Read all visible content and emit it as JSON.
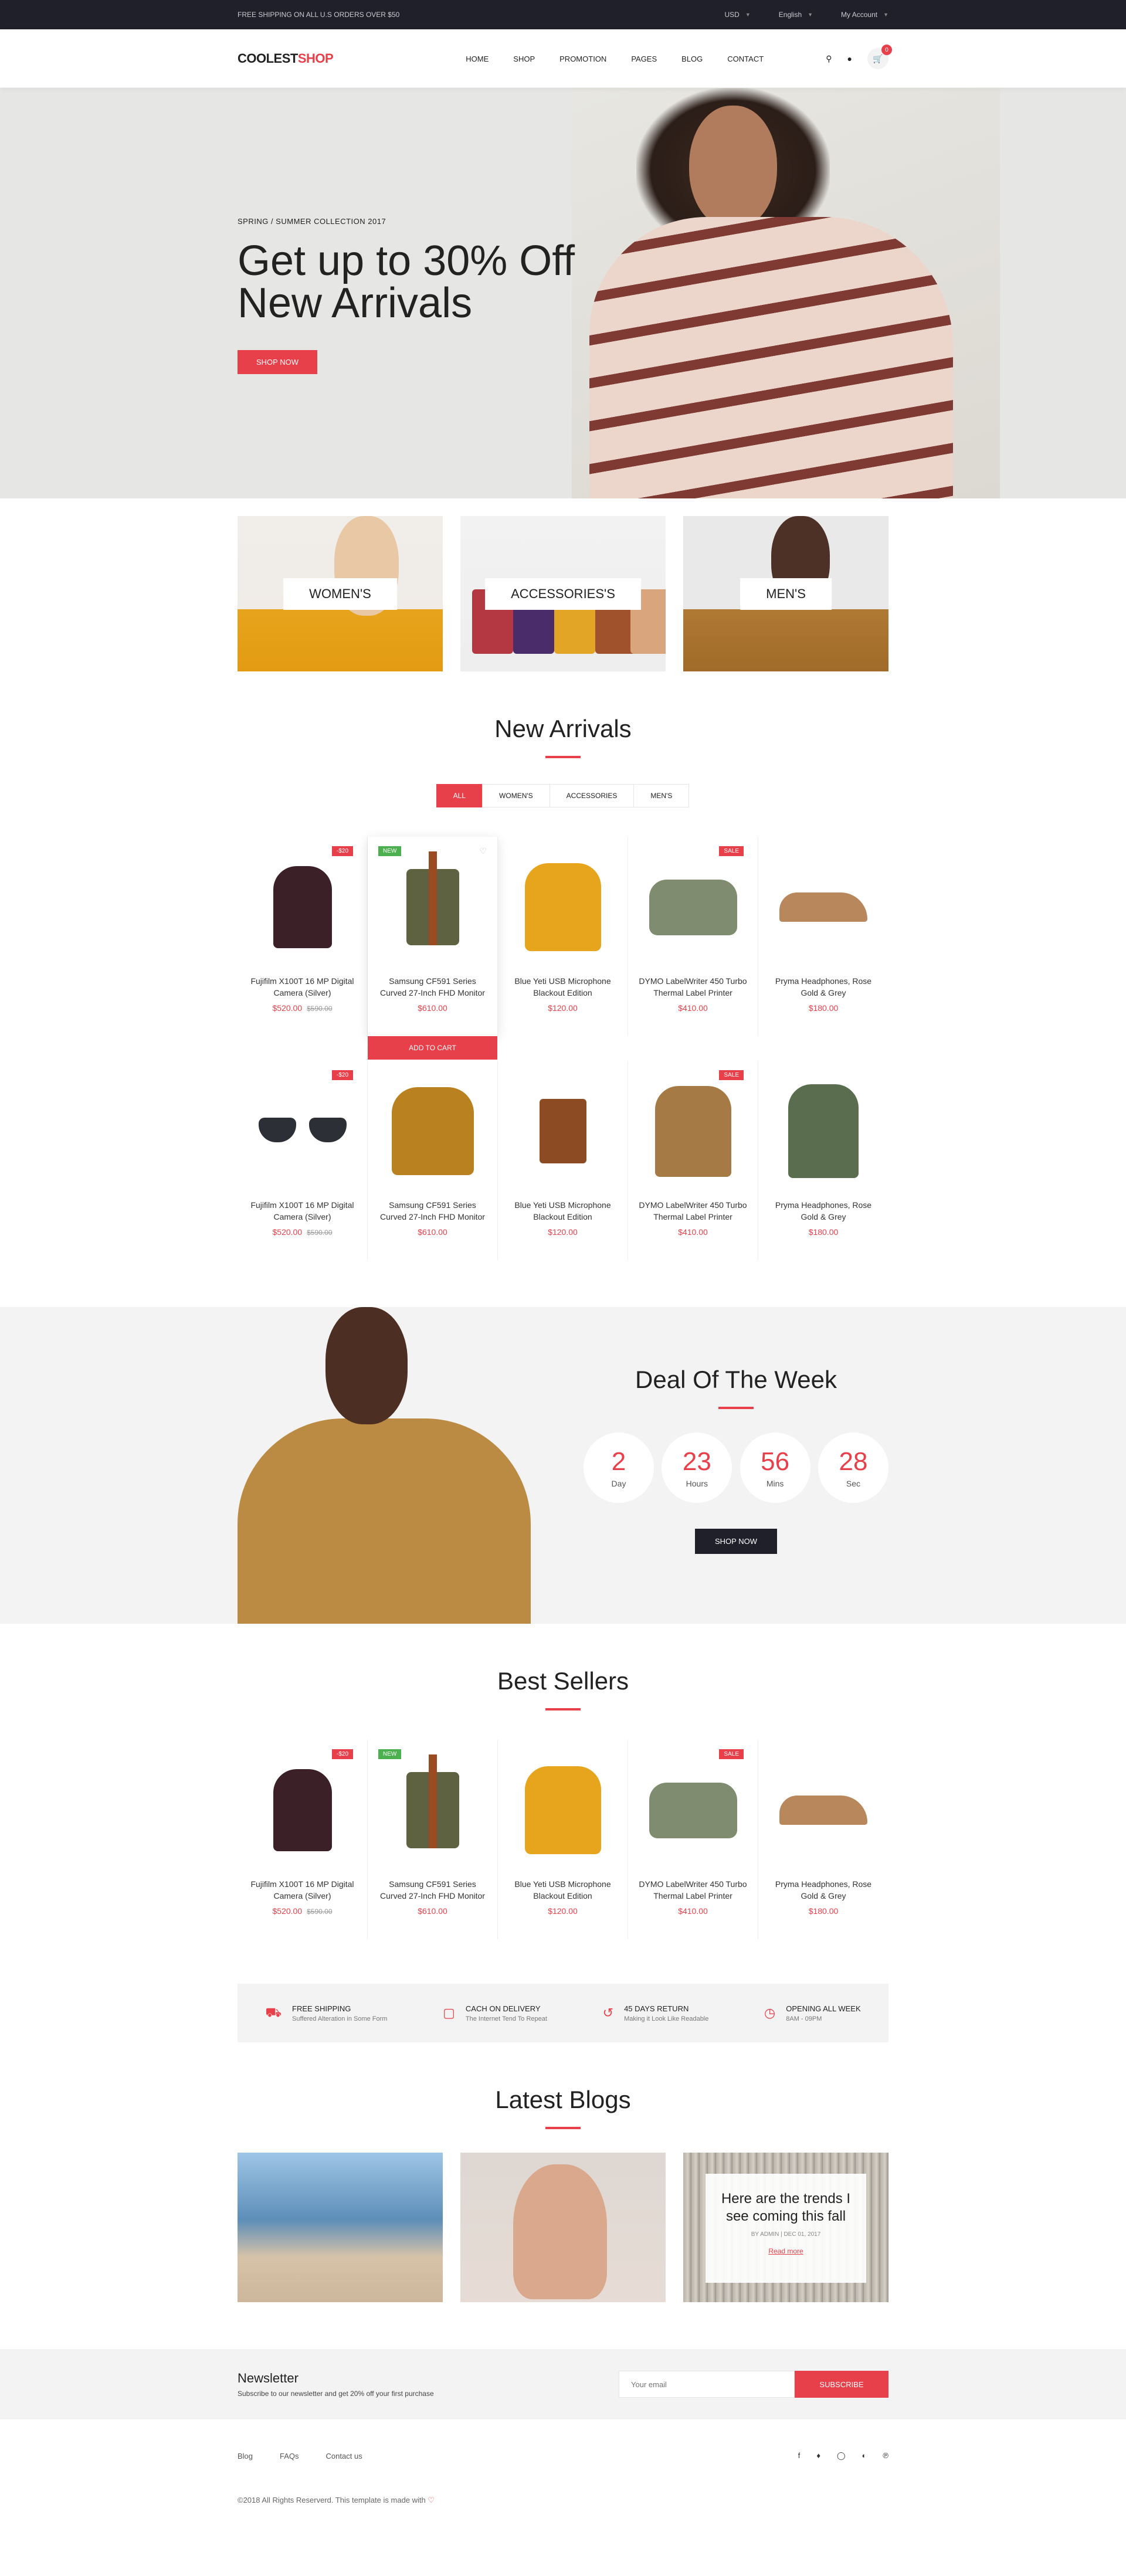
{
  "topbar": {
    "shipping": "FREE SHIPPING ON ALL U.S ORDERS OVER $50",
    "currency": "USD",
    "language": "English",
    "account": "My Account"
  },
  "header": {
    "logo_a": "COOLEST",
    "logo_b": "SHOP",
    "nav": [
      "HOME",
      "SHOP",
      "PROMOTION",
      "PAGES",
      "BLOG",
      "CONTACT"
    ],
    "cart_count": "0"
  },
  "hero": {
    "subtitle": "SPRING / SUMMER COLLECTION 2017",
    "title": "Get up to 30% Off New Arrivals",
    "button": "SHOP NOW"
  },
  "categories": [
    "WOMEN'S",
    "ACCESSORIES'S",
    "MEN'S"
  ],
  "new_arrivals": {
    "title": "New Arrivals",
    "filters": [
      "ALL",
      "WOMEN'S",
      "ACCESSORIES",
      "MEN'S"
    ],
    "add_to_cart": "ADD TO CART",
    "row1": [
      {
        "name": "Fujifilm X100T 16 MP Digital Camera (Silver)",
        "price": "$520.00",
        "old": "$590.00",
        "tag": "-$20"
      },
      {
        "name": "Samsung CF591 Series Curved 27-Inch FHD Monitor",
        "price": "$610.00",
        "tag": "NEW"
      },
      {
        "name": "Blue Yeti USB Microphone Blackout Edition",
        "price": "$120.00"
      },
      {
        "name": "DYMO LabelWriter 450 Turbo Thermal Label Printer",
        "price": "$410.00",
        "tag": "SALE"
      },
      {
        "name": "Pryma Headphones, Rose Gold & Grey",
        "price": "$180.00"
      }
    ],
    "row2": [
      {
        "name": "Fujifilm X100T 16 MP Digital Camera (Silver)",
        "price": "$520.00",
        "old": "$590.00",
        "tag": "-$20"
      },
      {
        "name": "Samsung CF591 Series Curved 27-Inch FHD Monitor",
        "price": "$610.00"
      },
      {
        "name": "Blue Yeti USB Microphone Blackout Edition",
        "price": "$120.00"
      },
      {
        "name": "DYMO LabelWriter 450 Turbo Thermal Label Printer",
        "price": "$410.00",
        "tag": "SALE"
      },
      {
        "name": "Pryma Headphones, Rose Gold & Grey",
        "price": "$180.00"
      }
    ]
  },
  "deal": {
    "title": "Deal Of The Week",
    "countdown": [
      {
        "num": "2",
        "label": "Day"
      },
      {
        "num": "23",
        "label": "Hours"
      },
      {
        "num": "56",
        "label": "Mins"
      },
      {
        "num": "28",
        "label": "Sec"
      }
    ],
    "button": "SHOP NOW"
  },
  "best_sellers": {
    "title": "Best Sellers",
    "items": [
      {
        "name": "Fujifilm X100T 16 MP Digital Camera (Silver)",
        "price": "$520.00",
        "old": "$590.00",
        "tag": "-$20"
      },
      {
        "name": "Samsung CF591 Series Curved 27-Inch FHD Monitor",
        "price": "$610.00",
        "tag": "NEW"
      },
      {
        "name": "Blue Yeti USB Microphone Blackout Edition",
        "price": "$120.00"
      },
      {
        "name": "DYMO LabelWriter 450 Turbo Thermal Label Printer",
        "price": "$410.00",
        "tag": "SALE"
      },
      {
        "name": "Pryma Headphones, Rose Gold & Grey",
        "price": "$180.00"
      }
    ]
  },
  "features": [
    {
      "title": "FREE SHIPPING",
      "sub": "Suffered Alteration in Some Form"
    },
    {
      "title": "CACH ON DELIVERY",
      "sub": "The Internet Tend To Repeat"
    },
    {
      "title": "45 DAYS RETURN",
      "sub": "Making it Look Like Readable"
    },
    {
      "title": "OPENING ALL WEEK",
      "sub": "8AM - 09PM"
    }
  ],
  "blogs": {
    "title": "Latest Blogs",
    "card_title": "Here are the trends I see coming this fall",
    "card_meta": "BY ADMIN | DEC 01, 2017",
    "card_link": "Read more"
  },
  "newsletter": {
    "title": "Newsletter",
    "sub": "Subscribe to our newsletter and get 20% off your first purchase",
    "placeholder": "Your email",
    "button": "SUBSCRIBE"
  },
  "footer": {
    "links": [
      "Blog",
      "FAQs",
      "Contact us"
    ],
    "copyright": "©2018 All Rights Reserverd. This template is made with"
  },
  "colors": {
    "accent": "#e8404a",
    "dark": "#1f2029",
    "new_badge": "#4caf50"
  }
}
